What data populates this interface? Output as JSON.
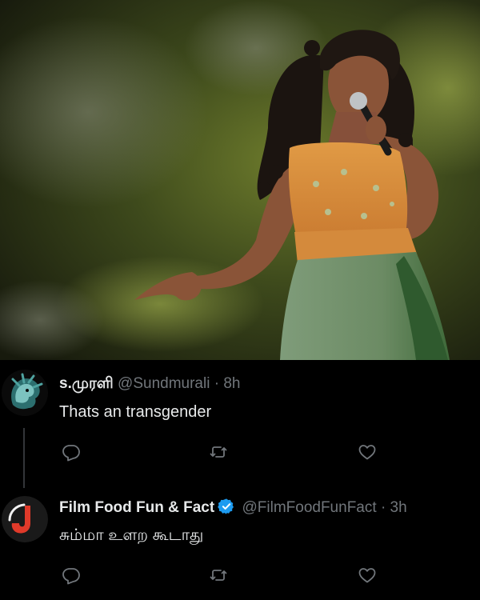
{
  "post_image": {
    "alt": "",
    "colors": {
      "background": "#2b3517",
      "dress_top": "#d5873a",
      "skirt": "#6f8e68"
    }
  },
  "tweets": [
    {
      "display_name": "s.முரளி",
      "handle": "@Sundmurali",
      "separator": "·",
      "time": "8h",
      "text": "Thats an transgender",
      "verified": false,
      "avatar_icon": "lion-avatar-icon",
      "actions": [
        {
          "icon": "reply-icon"
        },
        {
          "icon": "retweet-icon"
        },
        {
          "icon": "like-icon"
        }
      ]
    },
    {
      "display_name": "Film Food Fun & Fact",
      "handle": "@FilmFoodFunFact",
      "separator": "·",
      "time": "3h",
      "text": "சும்மா உளற கூடாது",
      "verified": true,
      "avatar_icon": "j-logo-avatar-icon",
      "actions": [
        {
          "icon": "reply-icon"
        },
        {
          "icon": "retweet-icon"
        },
        {
          "icon": "like-icon"
        }
      ]
    }
  ],
  "theme": {
    "background": "#000000",
    "text": "#e7e9ea",
    "muted": "#71767b",
    "verified": "#1d9bf0",
    "thread_line": "#333639"
  }
}
